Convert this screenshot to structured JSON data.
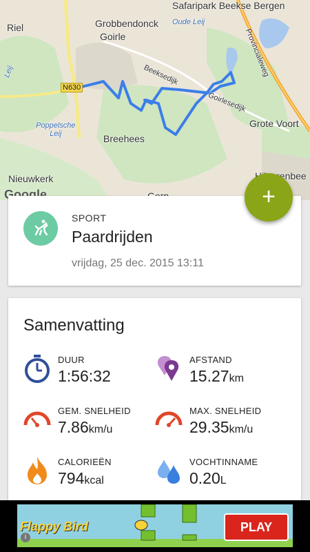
{
  "map": {
    "labels": {
      "safaripark": "Safaripark Beekse Bergen",
      "riel": "Riel",
      "grobbendonck": "Grobbendonck",
      "goirle": "Goirle",
      "oude_leij": "Oude Leij",
      "provincialeweg": "Provincialeweg",
      "leij": "Leij",
      "beeksedijk": "Beeksedijk",
      "goirlesedijk": "Goirlesedijk",
      "poppelsche_leij": "Poppelsche\nLeij",
      "grote_voort": "Grote Voort",
      "breehees": "Breehees",
      "nieuwkerk": "Nieuwkerk",
      "hilvarenbeek": "Hilvarenbee",
      "gorp": "Gorp"
    },
    "road_sign": "N630",
    "google_logo": "Google"
  },
  "fab": {
    "label": "+"
  },
  "sport": {
    "label": "SPORT",
    "name": "Paardrijden",
    "date": "vrijdag, 25 dec. 2015 13:11",
    "icon": "horse-riding-icon"
  },
  "summary": {
    "title": "Samenvatting",
    "stats": [
      {
        "label": "DUUR",
        "value": "1:56:32",
        "unit": "",
        "icon": "stopwatch-icon",
        "color": "#2f4f99"
      },
      {
        "label": "AFSTAND",
        "value": "15.27",
        "unit": "km",
        "icon": "location-pins-icon",
        "color": "#7a3a8f"
      },
      {
        "label": "GEM. SNELHEID",
        "value": "7.86",
        "unit": "km/u",
        "icon": "speedometer-icon",
        "color": "#e0462a"
      },
      {
        "label": "MAX. SNELHEID",
        "value": "29.35",
        "unit": "km/u",
        "icon": "speedometer-max-icon",
        "color": "#e0462a"
      },
      {
        "label": "CALORIEËN",
        "value": "794",
        "unit": "kcal",
        "icon": "flame-icon",
        "color": "#f08a1c"
      },
      {
        "label": "VOCHTINNAME",
        "value": "0.20",
        "unit": "L",
        "icon": "water-drops-icon",
        "color": "#3a7fe0"
      }
    ]
  },
  "ad": {
    "logo": "Flappy Bird",
    "play": "PLAY",
    "info": "i"
  }
}
